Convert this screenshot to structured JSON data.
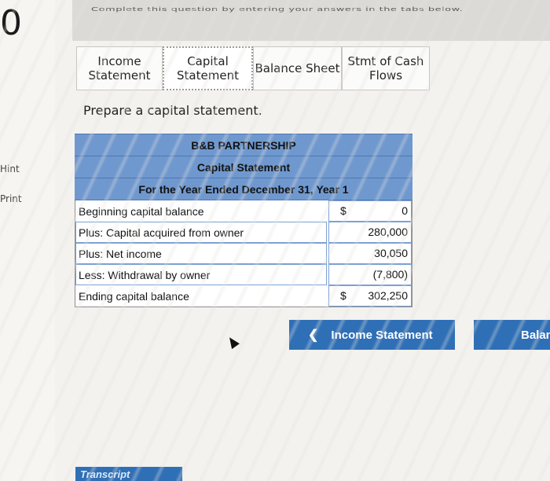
{
  "sidebar": {
    "big_digit": "0",
    "hint_label": "Hint",
    "print_label": "Print"
  },
  "header": {
    "instruction": "Complete this question by entering your answers in the tabs below."
  },
  "tabs": [
    {
      "line1": "Income",
      "line2": "Statement"
    },
    {
      "line1": "Capital",
      "line2": "Statement"
    },
    {
      "line1": "Balance Sheet",
      "line2": ""
    },
    {
      "line1": "Stmt of Cash",
      "line2": "Flows"
    }
  ],
  "main": {
    "prompt": "Prepare a capital statement."
  },
  "statement": {
    "company": "B&B PARTNERSHIP",
    "title": "Capital Statement",
    "period": "For the Year Ended December 31, Year 1",
    "rows": [
      {
        "label": "Beginning capital balance",
        "currency": "$",
        "amount": "0"
      },
      {
        "label": "Plus: Capital acquired from owner",
        "currency": "",
        "amount": "280,000"
      },
      {
        "label": "Plus: Net income",
        "currency": "",
        "amount": "30,050"
      },
      {
        "label": "Less: Withdrawal by owner",
        "currency": "",
        "amount": "(7,800)"
      },
      {
        "label": "Ending capital balance",
        "currency": "$",
        "amount": "302,250"
      }
    ]
  },
  "navigation": {
    "prev_label": "Income Statement",
    "next_label": "Balance Sheet",
    "prev_icon": "chevron-left-icon"
  },
  "footer": {
    "transcript_label": "Transcript"
  },
  "colors": {
    "header_blue": "#6f98cf",
    "button_blue": "#2f6fb6"
  }
}
